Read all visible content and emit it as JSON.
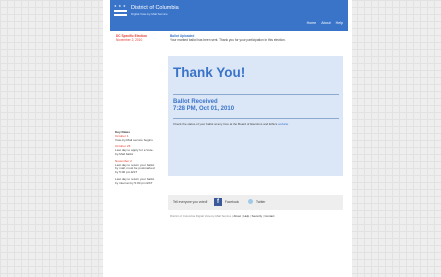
{
  "header": {
    "title": "District of Columbia",
    "subtitle": "Digital Vote-by-Mail Service",
    "nav": [
      "Home",
      "About",
      "Help"
    ]
  },
  "election": {
    "name": "DC Specific Election",
    "date": "November 2, 2010"
  },
  "ballot_status": {
    "title": "Ballot Uploaded",
    "message": "Your marked ballot has been sent. Thank you for your participation in this election."
  },
  "confirmation": {
    "heading": "Thank You!",
    "received_title": "Ballot Received",
    "received_time": "7:28 PM, Oct 01, 2010",
    "check_text": "Check the status of your ballot at any time at the Board of Elections and Ethics",
    "check_link": "website"
  },
  "key_dates": {
    "heading": "Key Dates",
    "items": [
      {
        "date": "October 1",
        "text": "Vote-by-Mail service begins"
      },
      {
        "date": "October 26",
        "text": "Last day to apply for a Vote-by-Mail ballot"
      },
      {
        "date": "November 2",
        "text": "Last day to return your ballot by mail, must be postmarked by 5:00 pm EST"
      },
      {
        "date": "",
        "text": "Last day to return your ballot by internet by 5:00 pm EST"
      }
    ]
  },
  "social": {
    "tell_text": "Tell everyone you voted!",
    "facebook_label": "Facebook",
    "twitter_label": "Twitter",
    "facebook_color": "#3b5998"
  },
  "footer": {
    "text": "District of Columbia Digital Vote-by-Mail Service",
    "links": [
      "About",
      "Help",
      "Security",
      "Contact"
    ]
  },
  "colors": {
    "brand_blue": "#3a74c9",
    "accent_red": "#e23b2e",
    "panel_bg": "#dbe6f6"
  }
}
